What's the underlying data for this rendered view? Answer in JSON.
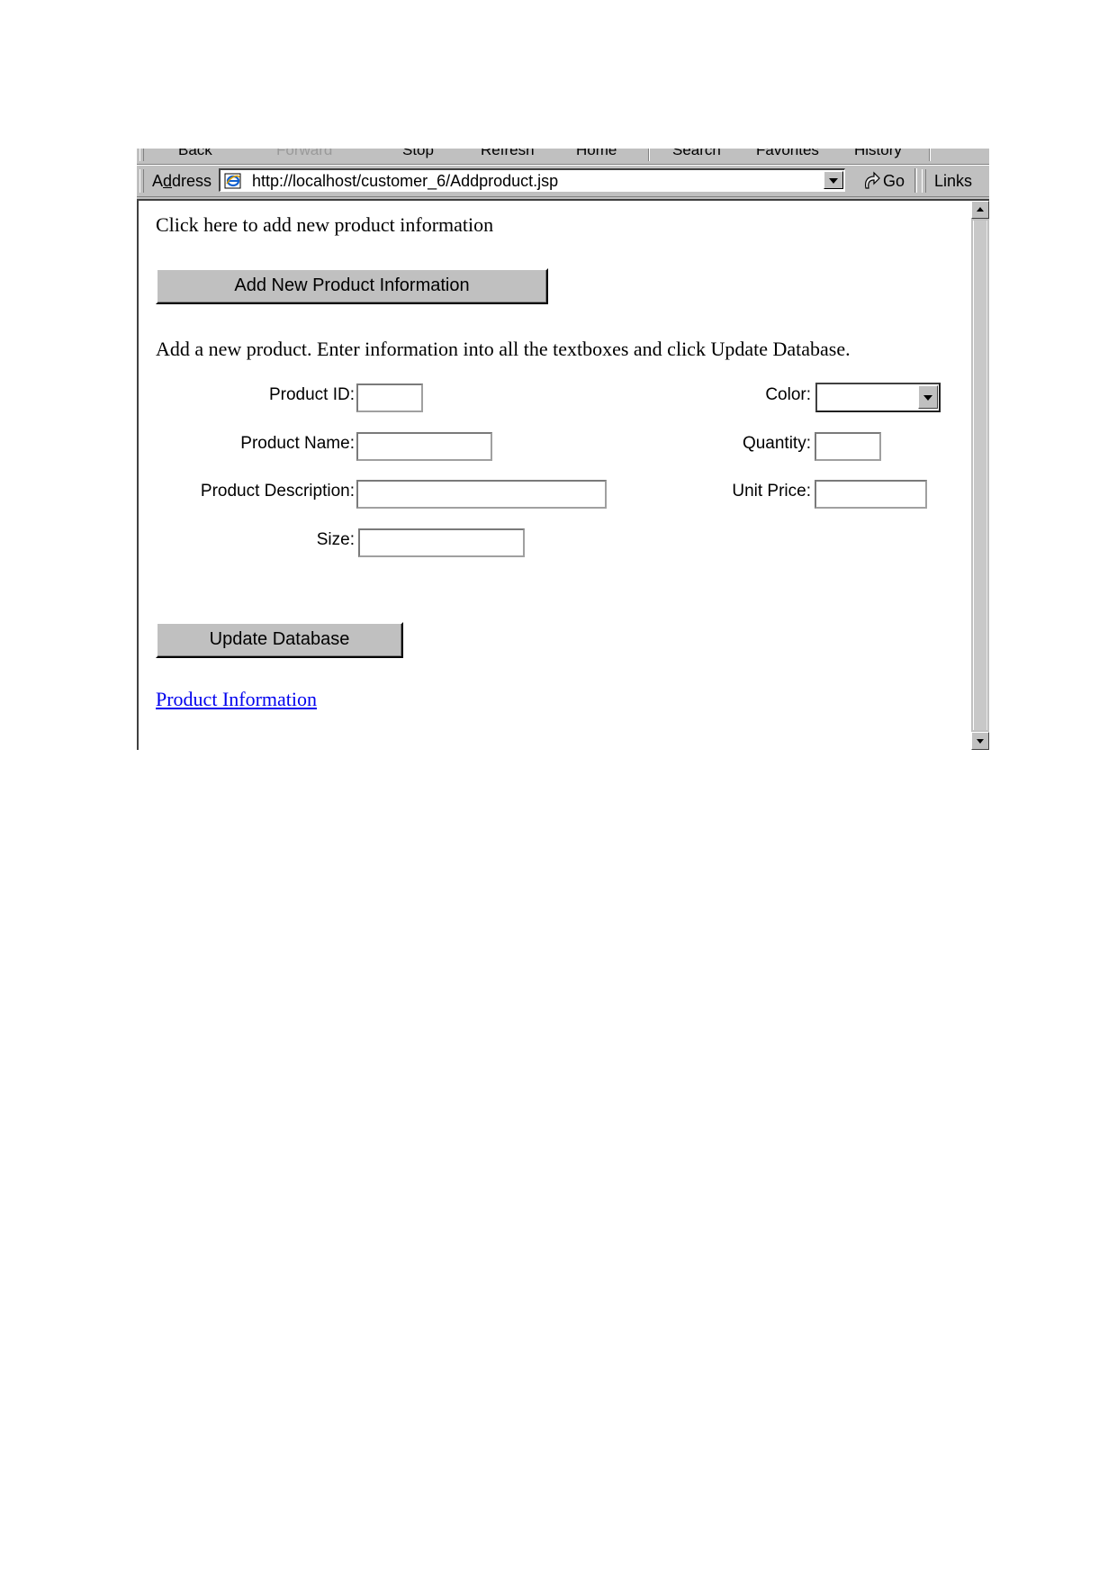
{
  "browser": {
    "toolbar": {
      "buttons": [
        {
          "label": "Back",
          "enabled": true
        },
        {
          "label": "Forward",
          "enabled": false
        },
        {
          "label": "Stop",
          "enabled": true
        },
        {
          "label": "Refresh",
          "enabled": true
        },
        {
          "label": "Home",
          "enabled": true
        },
        {
          "label": "Search",
          "enabled": true
        },
        {
          "label": "Favorites",
          "enabled": true
        },
        {
          "label": "History",
          "enabled": true
        }
      ]
    },
    "address_bar": {
      "label": "Address",
      "url": "http://localhost/customer_6/Addproduct.jsp",
      "page_icon": "ie-page-icon",
      "go_label": "Go",
      "links_label": "Links"
    }
  },
  "page": {
    "intro_text": "Click here to add new product information",
    "add_button_label": "Add New Product Information",
    "instructions": "Add a new product. Enter information into all the textboxes and click Update Database.",
    "form": {
      "product_id": {
        "label": "Product ID:",
        "value": ""
      },
      "product_name": {
        "label": "Product Name:",
        "value": ""
      },
      "product_description": {
        "label": "Product Description:",
        "value": ""
      },
      "size": {
        "label": "Size:",
        "value": ""
      },
      "color": {
        "label": "Color:",
        "selected": ""
      },
      "quantity": {
        "label": "Quantity:",
        "value": ""
      },
      "unit_price": {
        "label": "Unit Price:",
        "value": ""
      }
    },
    "update_button_label": "Update Database",
    "product_info_link": "Product Information"
  }
}
